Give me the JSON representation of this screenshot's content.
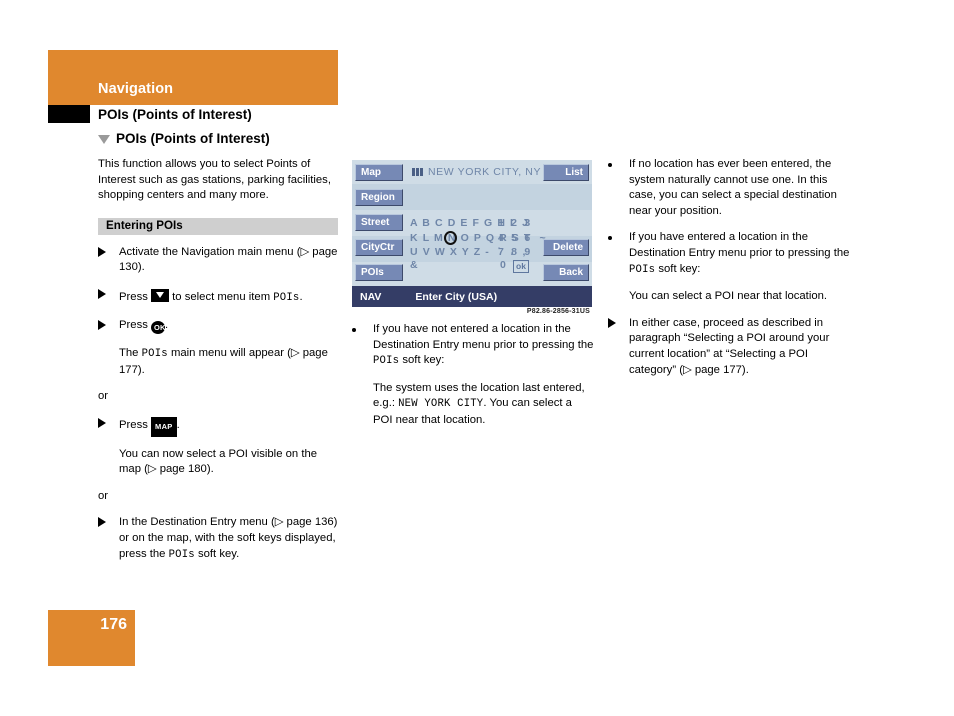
{
  "header": {
    "chapter": "Navigation",
    "title": "POIs (Points of Interest)",
    "section": "POIs (Points of Interest)"
  },
  "colors": {
    "accent_orange": "#e0882e",
    "subhead_grey": "#cfcfcf",
    "nav_screen_bg": "#c5d5e2",
    "nav_softkey": "#7689b5",
    "nav_statusbar": "#343d66",
    "nav_text_blue": "#6f86a8"
  },
  "left_column": {
    "intro": "This function allows you to select  Points of Interest such as gas stations, parking facilities, shopping centers and many more.",
    "subhead": "Entering POIs",
    "steps": [
      {
        "marker": "arrow",
        "text_parts": [
          {
            "t": "Activate the Navigation main menu (▷ page 130).",
            "style": "normal"
          }
        ]
      },
      {
        "marker": "arrow",
        "text_parts": [
          {
            "t": "Press ",
            "style": "normal"
          },
          {
            "t": "key-down",
            "style": "glyph"
          },
          {
            "t": " to select menu item ",
            "style": "normal"
          },
          {
            "t": "POIs",
            "style": "mono"
          },
          {
            "t": ".",
            "style": "normal"
          }
        ]
      },
      {
        "marker": "arrow",
        "text_parts": [
          {
            "t": "Press ",
            "style": "normal"
          },
          {
            "t": "key-ok",
            "style": "glyph"
          },
          {
            "t": ".",
            "style": "normal"
          }
        ]
      }
    ],
    "after_ok_lead": "The ",
    "after_ok_mono": "POIs",
    "after_ok_rest": " main menu will appear (▷ page 177).",
    "or_1": "or",
    "press_map_lead": "Press ",
    "press_map_trail": ".",
    "map_result": "You can now select a POI visible on the map (▷ page 180).",
    "or_2": "or",
    "dest_entry_lead": "In the Destination Entry menu (▷ page 136) or on the map, with the soft keys displayed, press the ",
    "dest_entry_mono": "POIs",
    "dest_entry_trail": " soft key."
  },
  "nav_screen": {
    "soft_keys_left": [
      "Map",
      "Region",
      "Street",
      "CityCtr",
      "POIs"
    ],
    "soft_keys_right": [
      "List",
      "Delete",
      "Back"
    ],
    "city_value": "NEW YORK CITY, NY",
    "keyboard_rows": [
      "A B C D E F G H I  J",
      "K L M N O P Q R S T  ~",
      "U V W X Y Z -  `  .  ,",
      "&"
    ],
    "number_rows": [
      "1 2 3",
      "4 5 6",
      "7 8 9",
      "0"
    ],
    "ok_chip": "ok",
    "status_tag": "NAV",
    "status_title": "Enter City (USA)",
    "caption": "P82.86-2856-31US"
  },
  "middle_column": {
    "bullets": [
      {
        "lead": "If you have not entered a location in the Destination Entry menu prior to pressing the ",
        "mono": "POIs",
        "trail": " soft key:"
      }
    ],
    "detail_lead": "The system uses the location last entered, e.g.: ",
    "detail_mono": "NEW YORK CITY",
    "detail_trail": ". You can select a POI near that location."
  },
  "right_column": {
    "bullet_1": "If no location has ever been entered, the system naturally cannot use one. In this case, you can select a special destination near your position.",
    "bullet_2_lead": "If you have entered a location in the Destination Entry menu prior to pressing the ",
    "bullet_2_mono": "POIs",
    "bullet_2_trail": " soft key:",
    "bullet_2_detail": "You can select a POI near that location.",
    "arrow_item": "In either case, proceed as described in paragraph “Selecting a POI around your current location” at “Selecting a POI category” (▷ page 177)."
  },
  "footer": {
    "page_number": "176"
  }
}
